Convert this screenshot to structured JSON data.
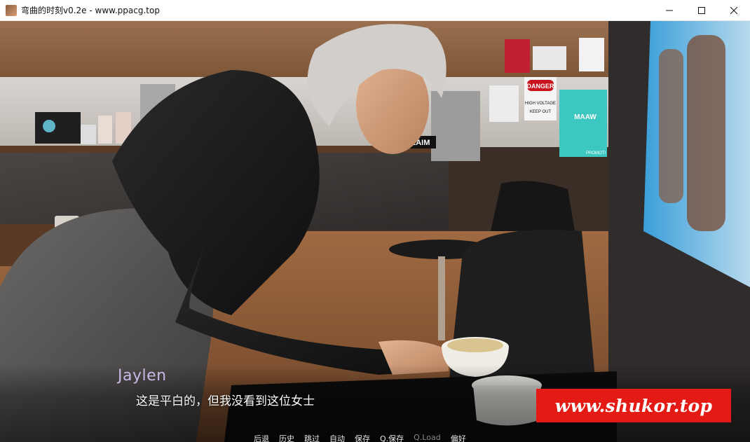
{
  "window": {
    "title": "弯曲的时刻v0.2e - www.ppacg.top",
    "icons": [
      "app-icon",
      "minimize-icon",
      "maximize-icon",
      "close-icon"
    ]
  },
  "scene": {
    "signs": {
      "danger": "DANGER",
      "high_voltage": "HIGH VOLTAGE",
      "keep_out": "KEEP OUT",
      "claim": "CLAIM",
      "poster_text": "MAAW",
      "poster_promo": "PROMOTI"
    }
  },
  "dialogue": {
    "speaker": "Jaylen",
    "text": "这是平白的，但我没看到这位女士",
    "speaker_color": "#c9b8e6"
  },
  "quick_menu": [
    {
      "label": "后退",
      "enabled": true
    },
    {
      "label": "历史",
      "enabled": true
    },
    {
      "label": "跳过",
      "enabled": true
    },
    {
      "label": "自动",
      "enabled": true
    },
    {
      "label": "保存",
      "enabled": true
    },
    {
      "label": "Q.保存",
      "enabled": true
    },
    {
      "label": "Q.Load",
      "enabled": false
    },
    {
      "label": "偏好",
      "enabled": true
    }
  ],
  "watermark": {
    "text": "www.shukor.top",
    "color": "#e31b14"
  }
}
